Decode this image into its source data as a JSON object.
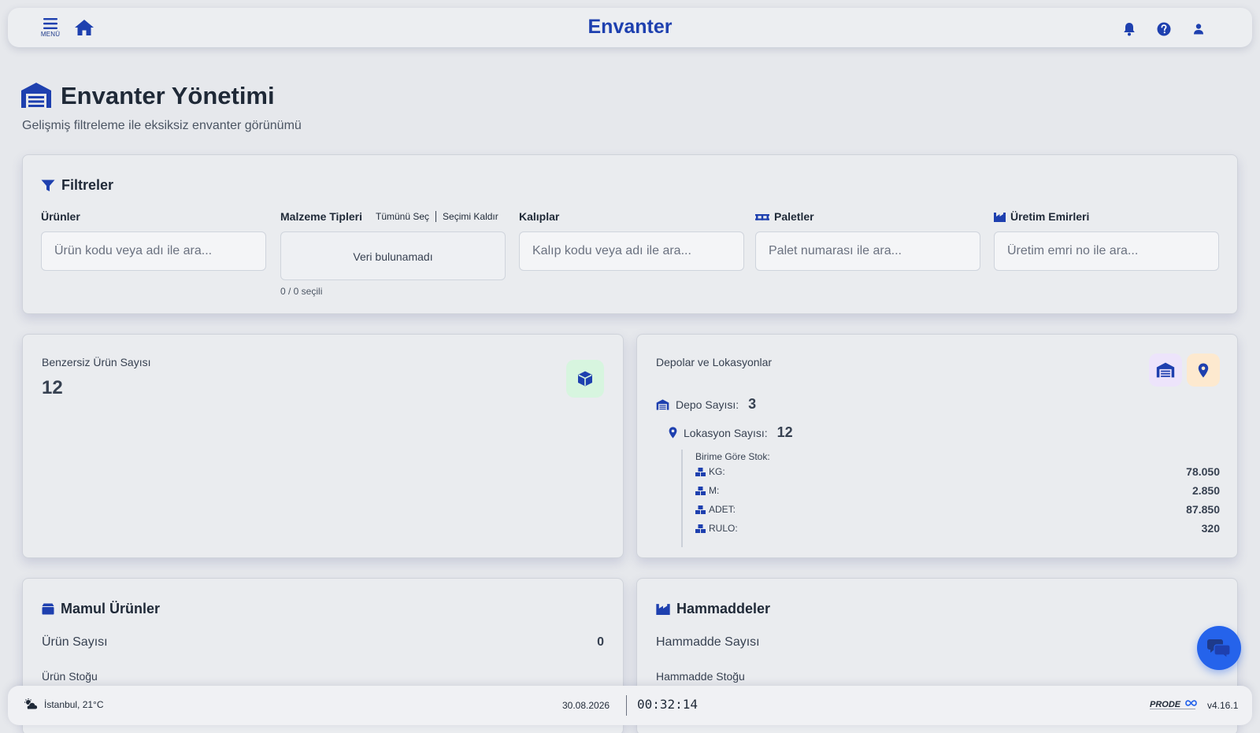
{
  "topbar": {
    "menu_label": "MENÜ",
    "title": "Envanter"
  },
  "page": {
    "title": "Envanter Yönetimi",
    "subtitle": "Gelişmiş filtreleme ile eksiksiz envanter görünümü"
  },
  "filters": {
    "title": "Filtreler",
    "products": {
      "label": "Ürünler",
      "placeholder": "Ürün kodu veya adı ile ara..."
    },
    "material_types": {
      "label": "Malzeme Tipleri",
      "select_all": "Tümünü Seç",
      "clear_selection": "Seçimi Kaldır",
      "empty_text": "Veri bulunamadı",
      "selected_count": "0 / 0 seçili"
    },
    "molds": {
      "label": "Kalıplar",
      "placeholder": "Kalıp kodu veya adı ile ara..."
    },
    "pallets": {
      "label": "Paletler",
      "placeholder": "Palet numarası ile ara..."
    },
    "work_orders": {
      "label": "Üretim Emirleri",
      "placeholder": "Üretim emri no ile ara..."
    }
  },
  "unique_products": {
    "label": "Benzersiz Ürün Sayısı",
    "value": "12"
  },
  "warehouses": {
    "label": "Depolar ve Lokasyonlar",
    "depot_label": "Depo Sayısı:",
    "depot_value": "3",
    "location_label": "Lokasyon Sayısı:",
    "location_value": "12",
    "unit_title": "Birime Göre Stok:",
    "units": [
      {
        "name": "KG:",
        "value": "78.050"
      },
      {
        "name": "M:",
        "value": "2.850"
      },
      {
        "name": "ADET:",
        "value": "87.850"
      },
      {
        "name": "RULO:",
        "value": "320"
      }
    ]
  },
  "finished_products": {
    "title": "Mamul Ürünler",
    "count_label": "Ürün Sayısı",
    "count_value": "0",
    "stock_label": "Ürün Stoğu"
  },
  "raw_materials": {
    "title": "Hammaddeler",
    "count_label": "Hammadde Sayısı",
    "stock_label": "Hammadde Stoğu"
  },
  "footer": {
    "weather": "İstanbul, 21°C",
    "date": "30.08.2026",
    "time": "00:32:14",
    "logo_text": "PRODE",
    "version": "v4.16.1"
  },
  "colors": {
    "accent": "#1e40af",
    "fab": "#2563eb",
    "badge_green": "#d7f5df",
    "badge_purple": "#ede4fb",
    "badge_orange": "#fde9cf"
  }
}
